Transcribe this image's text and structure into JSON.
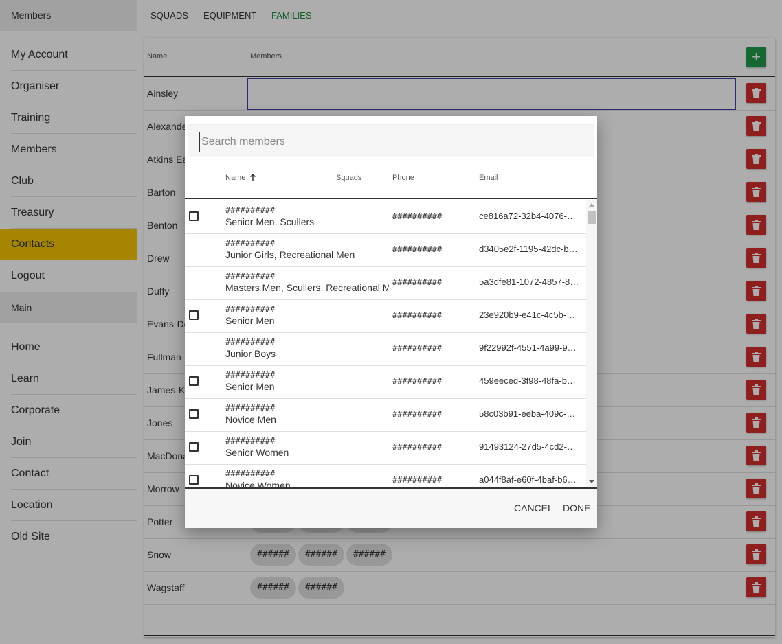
{
  "sidebar": {
    "header": "Members",
    "account_items": [
      "My Account",
      "Organiser",
      "Training",
      "Members",
      "Club",
      "Treasury",
      "Contacts",
      "Logout"
    ],
    "active_item": "Contacts",
    "section": "Main",
    "main_items": [
      "Home",
      "Learn",
      "Corporate",
      "Join",
      "Contact",
      "Location",
      "Old Site"
    ]
  },
  "tabs": [
    "SQUADS",
    "EQUIPMENT",
    "FAMILIES"
  ],
  "active_tab": "FAMILIES",
  "families_table": {
    "col_name": "Name",
    "col_members": "Members",
    "add_label": "+",
    "rows": [
      {
        "name": "Ainsley",
        "chips": []
      },
      {
        "name": "Alexander",
        "chips": []
      },
      {
        "name": "Atkins Earl",
        "chips": []
      },
      {
        "name": "Barton",
        "chips": []
      },
      {
        "name": "Benton",
        "chips": []
      },
      {
        "name": "Drew",
        "chips": []
      },
      {
        "name": "Duffy",
        "chips": []
      },
      {
        "name": "Evans-Dey",
        "chips": []
      },
      {
        "name": "Fullman",
        "chips": []
      },
      {
        "name": "James-K",
        "chips": []
      },
      {
        "name": "Jones",
        "chips": []
      },
      {
        "name": "MacDonald",
        "chips": []
      },
      {
        "name": "Morrow",
        "chips": []
      },
      {
        "name": "Potter",
        "chips": [
          "######",
          "######",
          "######"
        ]
      },
      {
        "name": "Snow",
        "chips": [
          "######",
          "######",
          "######"
        ]
      },
      {
        "name": "Wagstaff",
        "chips": [
          "######",
          "######"
        ]
      }
    ]
  },
  "dialog": {
    "search_placeholder": "Search members",
    "col_name": "Name",
    "col_squads": "Squads",
    "col_phone": "Phone",
    "col_email": "Email",
    "sort_icon": "arrow-up",
    "members": [
      {
        "name": "##########",
        "squads": "Senior Men, Scullers",
        "phone": "##########",
        "email": "ce816a72-32b4-4076-…",
        "checkbox": true
      },
      {
        "name": "##########",
        "squads": "Junior Girls, Recreational Men",
        "phone": "##########",
        "email": "d3405e2f-1195-42dc-b…",
        "checkbox": false
      },
      {
        "name": "##########",
        "squads": "Masters Men, Scullers, Recreational M",
        "phone": "##########",
        "email": "5a3dfe81-1072-4857-8…",
        "checkbox": false
      },
      {
        "name": "##########",
        "squads": "Senior Men",
        "phone": "##########",
        "email": "23e920b9-e41c-4c5b-…",
        "checkbox": true
      },
      {
        "name": "##########",
        "squads": "Junior Boys",
        "phone": "##########",
        "email": "9f22992f-4551-4a99-9…",
        "checkbox": false
      },
      {
        "name": "##########",
        "squads": "Senior Men",
        "phone": "##########",
        "email": "459eeced-3f98-48fa-b…",
        "checkbox": true
      },
      {
        "name": "##########",
        "squads": "Novice Men",
        "phone": "##########",
        "email": "58c03b91-eeba-409c-…",
        "checkbox": true
      },
      {
        "name": "##########",
        "squads": "Senior Women",
        "phone": "##########",
        "email": "91493124-27d5-4cd2-…",
        "checkbox": true
      },
      {
        "name": "##########",
        "squads": "Novice Women",
        "phone": "##########",
        "email": "a044f8af-e60f-4baf-b6…",
        "checkbox": true
      }
    ],
    "cancel": "CANCEL",
    "done": "DONE"
  }
}
